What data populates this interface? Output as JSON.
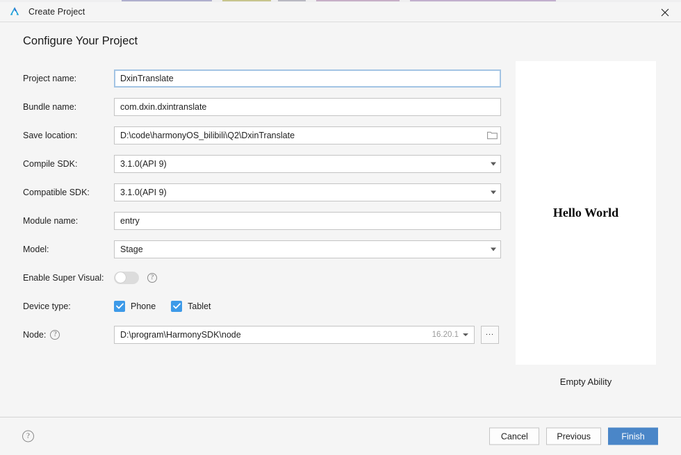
{
  "window": {
    "title": "Create Project",
    "logo_icon": "deveco-studio-logo-icon",
    "close_icon": "close-icon"
  },
  "page": {
    "heading": "Configure Your Project"
  },
  "form": {
    "project_name": {
      "label": "Project name:",
      "value": "DxinTranslate",
      "placeholder": "Project name"
    },
    "bundle_name": {
      "label": "Bundle name:",
      "value": "com.dxin.dxintranslate",
      "placeholder": "Bundle name"
    },
    "save_location": {
      "label": "Save location:",
      "value": "D:\\code\\harmonyOS_bilibili\\Q2\\DxinTranslate",
      "placeholder": "Save location",
      "browse_icon": "folder-icon"
    },
    "compile_sdk": {
      "label": "Compile SDK:",
      "value": "3.1.0(API 9)"
    },
    "compatible_sdk": {
      "label": "Compatible SDK:",
      "value": "3.1.0(API 9)"
    },
    "module_name": {
      "label": "Module name:",
      "value": "entry",
      "placeholder": "Module name"
    },
    "model": {
      "label": "Model:",
      "value": "Stage"
    },
    "enable_super_visual": {
      "label": "Enable Super Visual:",
      "state": "off",
      "help_glyph": "?"
    },
    "device_type": {
      "label": "Device type:",
      "options": [
        {
          "label": "Phone",
          "checked": true
        },
        {
          "label": "Tablet",
          "checked": true
        }
      ]
    },
    "node": {
      "label": "Node:",
      "help_glyph": "?",
      "value": "D:\\program\\HarmonySDK\\node",
      "version": "16.20.1",
      "browse_label": "..."
    }
  },
  "preview": {
    "screen_text": "Hello World",
    "caption": "Empty Ability"
  },
  "footer": {
    "help_glyph": "?",
    "cancel_label": "Cancel",
    "previous_label": "Previous",
    "finish_label": "Finish"
  },
  "colors": {
    "accent": "#4a86c8",
    "checkbox": "#3d9ae8",
    "focus_border": "#a3c4e4",
    "dialog_bg": "#f5f5f5"
  }
}
